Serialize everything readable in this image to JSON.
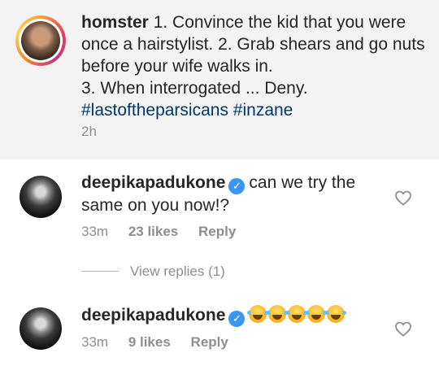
{
  "caption": {
    "username": "homster",
    "text": "1. Convince the kid that you were once a hairstylist.  2. Grab shears and go nuts before your wife walks in.",
    "line3": "3.  When interrogated ... Deny.",
    "hashtags": [
      "#lastoftheparsicans",
      "#inzane"
    ],
    "time": "2h"
  },
  "comments": [
    {
      "username": "deepikapadukone",
      "text": "can we try the same on you now!?",
      "time": "33m",
      "likes": "23 likes",
      "reply": "Reply",
      "view_replies": "View replies (1)"
    },
    {
      "username": "deepikapadukone",
      "emoji_count": 5,
      "emoji": "face-with-tears-of-joy",
      "time": "33m",
      "likes": "9 likes",
      "reply": "Reply"
    }
  ],
  "icons": {
    "verified": "verified-badge-icon",
    "like": "heart-outline-icon"
  },
  "colors": {
    "caption_bg": "#f3f3f3",
    "hashtag": "#00376b",
    "verified": "#3897f0",
    "meta": "#8e8e8e"
  }
}
